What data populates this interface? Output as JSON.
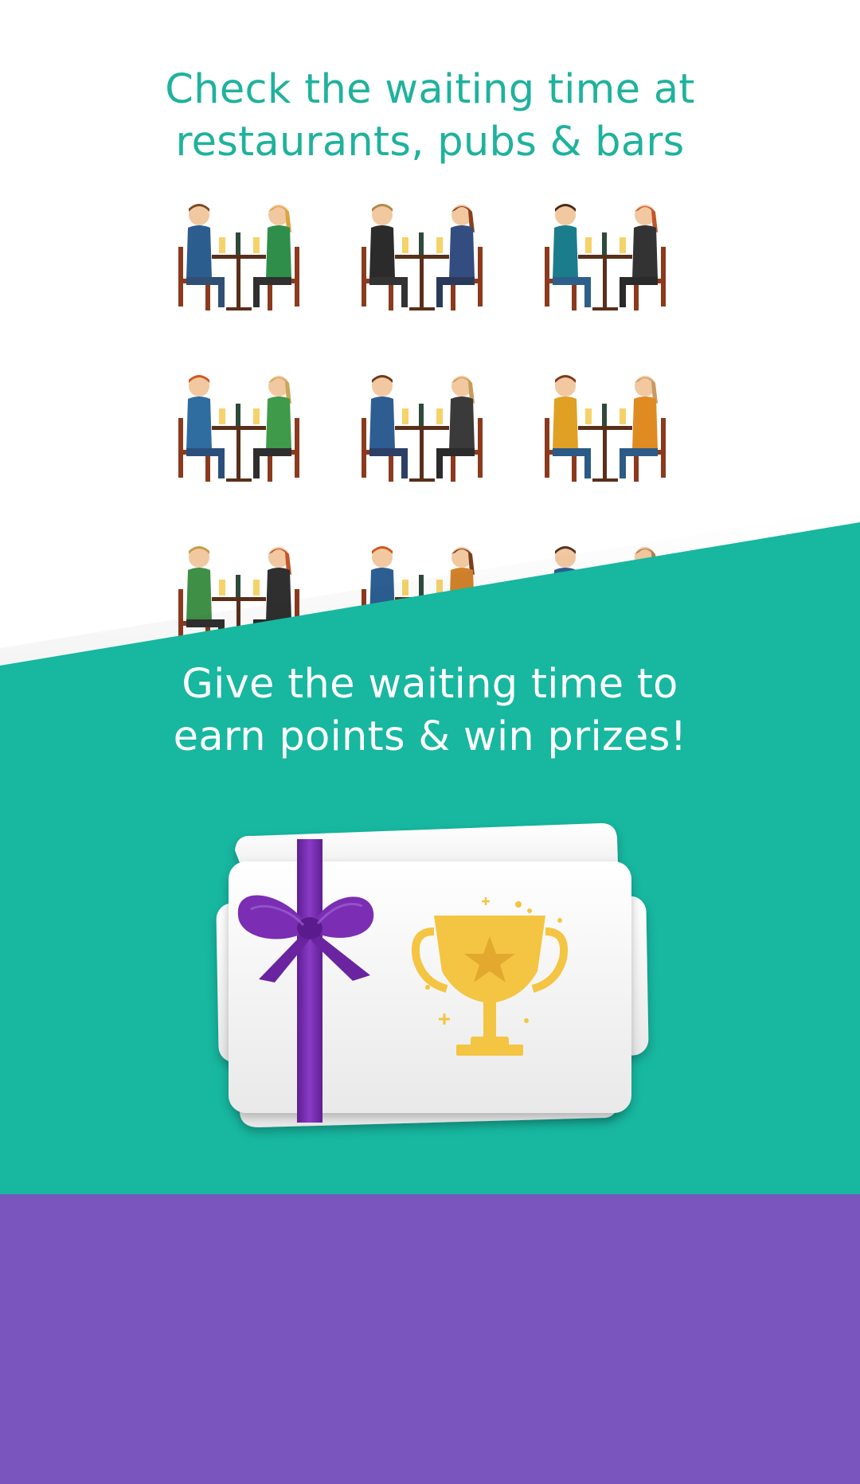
{
  "promo": {
    "top_headline": {
      "line1": "Check the waiting time at",
      "line2": "restaurants, pubs & bars"
    },
    "bottom_headline": {
      "line1": "Give the waiting time to",
      "line2": "earn points & win prizes!"
    }
  },
  "icons": {
    "dining_groups": "people-at-tables-icon",
    "gift_card": "gift-card-icon",
    "ribbon": "ribbon-bow-icon",
    "trophy": "trophy-icon"
  },
  "colors": {
    "accent_teal": "#17b7a0",
    "headline_teal": "#1fb29c",
    "footer_purple": "#7a55bd",
    "ribbon_purple": "#7b2db3",
    "trophy_gold": "#f4c542"
  }
}
